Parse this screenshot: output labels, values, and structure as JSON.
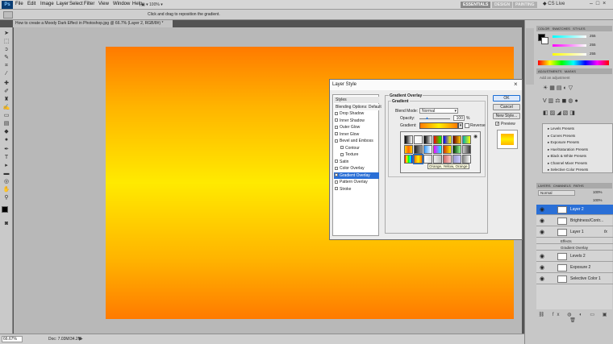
{
  "app": {
    "logo": "Ps"
  },
  "menu": [
    "File",
    "Edit",
    "Image",
    "Layer",
    "Select",
    "Filter",
    "View",
    "Window",
    "Help"
  ],
  "zoom_level": "100%",
  "workspaces": [
    "ESSENTIALS",
    "DESIGN",
    "PAINTING"
  ],
  "cs_live": "CS Live",
  "options_hint": "Click and drag to reposition the gradient.",
  "document_tab": "How to create a Moody Dark Effect in Photoshop.jpg @ 66.7% (Layer 2, RGB/8#) *",
  "status": {
    "zoom": "66.67%",
    "doc": "Doc: 7.03M/34.2M"
  },
  "panels": {
    "color_tabs": [
      "COLOR",
      "SWATCHES",
      "STYLES"
    ],
    "color_values": [
      "255",
      "255",
      "255"
    ],
    "adjust_tabs": [
      "ADJUSTMENTS",
      "MASKS"
    ],
    "adjust_hint": "Add an adjustment",
    "presets": [
      "Levels Presets",
      "Curves Presets",
      "Exposure Presets",
      "Hue/Saturation Presets",
      "Black & White Presets",
      "Channel Mixer Presets",
      "Selective Color Presets"
    ],
    "layers_tabs": [
      "LAYERS",
      "CHANNELS",
      "PATHS"
    ],
    "blend": "Normal",
    "opacity": "100%",
    "fill": "100%",
    "layers": [
      {
        "name": "Layer 2",
        "selected": true
      },
      {
        "name": "Brightness/Contr...",
        "selected": false
      },
      {
        "name": "Layer 1",
        "selected": false,
        "fx": "fx"
      },
      {
        "name": "Effects",
        "selected": false,
        "sub": true
      },
      {
        "name": "Gradient Overlay",
        "selected": false,
        "sub": true
      },
      {
        "name": "Levels 2",
        "selected": false
      },
      {
        "name": "Exposure 2",
        "selected": false
      },
      {
        "name": "Selective Color 1",
        "selected": false
      }
    ]
  },
  "dialog": {
    "title": "Layer Style",
    "styles": [
      {
        "label": "Styles",
        "check": false
      },
      {
        "label": "Blending Options: Default",
        "check": false
      },
      {
        "label": "Drop Shadow",
        "check": true
      },
      {
        "label": "Inner Shadow",
        "check": true
      },
      {
        "label": "Outer Glow",
        "check": true
      },
      {
        "label": "Inner Glow",
        "check": true
      },
      {
        "label": "Bevel and Emboss",
        "check": true
      },
      {
        "label": "Contour",
        "check": true,
        "indent": true
      },
      {
        "label": "Texture",
        "check": true,
        "indent": true
      },
      {
        "label": "Satin",
        "check": true
      },
      {
        "label": "Color Overlay",
        "check": true
      },
      {
        "label": "Gradient Overlay",
        "check": true,
        "selected": true
      },
      {
        "label": "Pattern Overlay",
        "check": true
      },
      {
        "label": "Stroke",
        "check": true
      }
    ],
    "group_title": "Gradient Overlay",
    "subgroup_title": "Gradient",
    "blend_mode_label": "Blend Mode:",
    "blend_mode_value": "Normal",
    "opacity_label": "Opacity:",
    "opacity_value": "100",
    "opacity_unit": "%",
    "gradient_label": "Gradient:",
    "reverse_label": "Reverse",
    "tooltip": "Orange, Yellow, Orange",
    "buttons": [
      "OK",
      "Cancel",
      "New Style..."
    ],
    "preview_label": "Preview"
  },
  "colors": {
    "accent_blue": "#1a6dd4",
    "selected_row": "#2a6fd6"
  }
}
